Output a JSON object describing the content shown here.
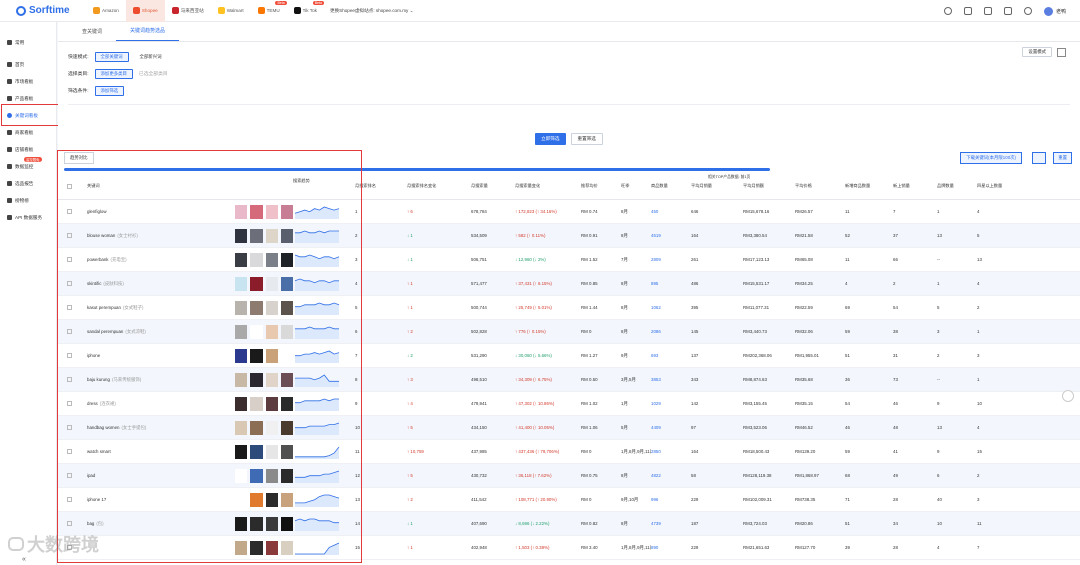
{
  "app": {
    "logo": "Sorftime"
  },
  "platforms": [
    {
      "label": "Amazon",
      "color": "#f29a1e"
    },
    {
      "label": "Shopee",
      "color": "#ee4d2d",
      "active": true
    },
    {
      "label": "马来西亚站",
      "color": "#c9252d"
    },
    {
      "label": "Walmart",
      "color": "#ffc220"
    },
    {
      "label": "TEMU",
      "color": "#fb7701",
      "badge": "Beta"
    },
    {
      "label": "Tik Tok",
      "color": "#111111",
      "badge": "Beta"
    }
  ],
  "site_select": "更换Shopee虚拟站点: shopee.com.my ⌄",
  "user": {
    "name": "老鸭"
  },
  "sidebar": {
    "items": [
      {
        "label": "常用"
      },
      {
        "label": "首页"
      },
      {
        "label": "市场看板"
      },
      {
        "label": "产品看板"
      },
      {
        "label": "关键词看板",
        "active": true
      },
      {
        "label": "商家看板"
      },
      {
        "label": "店铺看板"
      },
      {
        "label": "数据监控",
        "badge": "监控限免"
      },
      {
        "label": "选品报告"
      },
      {
        "label": "榜物榜"
      },
      {
        "label": "API 数据服务"
      }
    ]
  },
  "tabs": [
    {
      "label": "查关键词"
    },
    {
      "label": "关键词趋势选品",
      "active": true
    }
  ],
  "filters": {
    "quick_label": "快速模式:",
    "quick_opts": [
      "全部关键词",
      "全部新兴词"
    ],
    "category_label": "选择类目:",
    "category_btn": "添加更多类目",
    "category_hint": "已选全部类目",
    "condition_label": "筛选条件:",
    "condition_btn": "添加筛选",
    "mode_btn": "设置模式"
  },
  "actions": {
    "primary": "立即筛选",
    "reset": "重置筛选"
  },
  "toolbar": {
    "trend": "趋势对比",
    "download": "下载关键词(本月限100次)",
    "reset": "重置"
  },
  "table": {
    "headers": [
      "关键词",
      "搜索趋势",
      "月搜索排名",
      "月搜索排名变化",
      "月搜索量",
      "月搜索量变化",
      "推荐均价",
      "旺季",
      "商品数量",
      "平均月销量",
      "平均月销额",
      "平均价格",
      "新增商品数量",
      "新上销量",
      "品牌数量",
      "四星以上数量"
    ],
    "group_header": "相关TOP产品数据: 前1页",
    "rows": [
      {
        "kw": "glenfiglow",
        "sub": "",
        "rank": "1",
        "chg": "↑ 6",
        "chgDir": "up",
        "search": "678,784",
        "growth": "↑ 172,823 (↑ 34.16%)",
        "gDir": "up",
        "price": "RM 0.74",
        "season": "8月",
        "count": "450",
        "sales": "646",
        "gmv": "RM15,678.16",
        "avg": "RM26.57",
        "new": "11",
        "sold": "7",
        "brand": "1",
        "star": "4",
        "spark": [
          3,
          4,
          5,
          4,
          6,
          5,
          7,
          6,
          5,
          6
        ],
        "thumbs": [
          "#e9b9c9",
          "#d46a7a",
          "#f0c0c8",
          "#c77e95"
        ]
      },
      {
        "kw": "blouse woman",
        "sub": "(女士衬衫)",
        "rank": "2",
        "chg": "↓ 1",
        "chgDir": "down",
        "search": "534,509",
        "growth": "↑ 582 (↑ 0.11%)",
        "gDir": "up",
        "price": "RM 0.91",
        "season": "8月",
        "count": "4519",
        "sales": "164",
        "gmv": "RM3,380.54",
        "avg": "RM21.58",
        "new": "52",
        "sold": "37",
        "brand": "13",
        "star": "5",
        "spark": [
          5,
          5,
          6,
          5,
          5,
          6,
          5,
          6,
          6,
          6
        ],
        "thumbs": [
          "#2f3340",
          "#6c6f7a",
          "#ddd5c8",
          "#5a5f6e"
        ]
      },
      {
        "kw": "powerbank",
        "sub": "(充电宝)",
        "rank": "3",
        "chg": "↓ 1",
        "chgDir": "down",
        "search": "506,751",
        "growth": "↓ 12,960 (↓ 2%)",
        "gDir": "down",
        "price": "RM 1.52",
        "season": "7月",
        "count": "2809",
        "sales": "261",
        "gmv": "RM17,123.13",
        "avg": "RM65.08",
        "new": "11",
        "sold": "66",
        "brand": "--",
        "star": "13",
        "spark": [
          6,
          5,
          5,
          6,
          5,
          4,
          5,
          5,
          4,
          5
        ],
        "thumbs": [
          "#3a3d44",
          "#d9d9dc",
          "#7a7f88",
          "#1f2226"
        ]
      },
      {
        "kw": "skintific",
        "sub": "(皮肤科技)",
        "rank": "4",
        "chg": "↑ 1",
        "chgDir": "up",
        "search": "571,477",
        "growth": "↑ 37,431 (↑ 6.15%)",
        "gDir": "up",
        "price": "RM 0.85",
        "season": "8月",
        "count": "895",
        "sales": "486",
        "gmv": "RM15,531.17",
        "avg": "RM34.25",
        "new": "4",
        "sold": "2",
        "brand": "1",
        "star": "4",
        "spark": [
          5,
          6,
          5,
          5,
          4,
          5,
          5,
          4,
          5,
          5
        ],
        "thumbs": [
          "#c9e4f1",
          "#8b1d2a",
          "#e6e9ee",
          "#4a6fa8"
        ]
      },
      {
        "kw": "kasut perempuan",
        "sub": "(女式鞋子)",
        "rank": "5",
        "chg": "↑ 1",
        "chgDir": "up",
        "search": "500,744",
        "growth": "↑ 25,749 (↑ 5.01%)",
        "gDir": "up",
        "price": "RM 1.44",
        "season": "8月",
        "count": "1062",
        "sales": "395",
        "gmv": "RM11,077.31",
        "avg": "RM22.59",
        "new": "69",
        "sold": "54",
        "brand": "5",
        "star": "2",
        "spark": [
          4,
          4,
          5,
          5,
          5,
          6,
          5,
          5,
          6,
          5
        ],
        "thumbs": [
          "#b8b3ad",
          "#8c7b6e",
          "#d8d2cc",
          "#5c534c"
        ]
      },
      {
        "kw": "sandal perempuan",
        "sub": "(女式凉鞋)",
        "rank": "6",
        "chg": "↑ 2",
        "chgDir": "up",
        "search": "502,828",
        "growth": "↑ 776 (↑ 0.15%)",
        "gDir": "up",
        "price": "RM 0",
        "season": "8月",
        "count": "2086",
        "sales": "145",
        "gmv": "RM3,440.73",
        "avg": "RM32.06",
        "new": "59",
        "sold": "38",
        "brand": "3",
        "star": "1",
        "spark": [
          5,
          5,
          5,
          6,
          5,
          5,
          5,
          6,
          5,
          5
        ],
        "thumbs": [
          "#a9a9a9",
          "#ffffff",
          "#e8c9b0",
          "#d9d9d9"
        ]
      },
      {
        "kw": "iphone",
        "sub": "",
        "rank": "7",
        "chg": "↓ 2",
        "chgDir": "down",
        "search": "531,290",
        "growth": "↓ 30,060 (↓ 5.66%)",
        "gDir": "down",
        "price": "RM 1.27",
        "season": "9月",
        "count": "693",
        "sales": "137",
        "gmv": "RM202,368.06",
        "avg": "RM1,955.01",
        "new": "51",
        "sold": "31",
        "brand": "2",
        "star": "3",
        "spark": [
          4,
          4,
          5,
          5,
          6,
          5,
          6,
          7,
          5,
          6
        ],
        "thumbs": [
          "#2b3a8f",
          "#1a1a1a",
          "#c9a27a",
          "#ffffff"
        ]
      },
      {
        "kw": "baju kurung",
        "sub": "(马来传统服饰)",
        "rank": "8",
        "chg": "↑ 3",
        "chgDir": "up",
        "search": "498,510",
        "growth": "↑ 34,309 (↑ 6.75%)",
        "gDir": "up",
        "price": "RM 0.50",
        "season": "3月,5月",
        "count": "3853",
        "sales": "343",
        "gmv": "RM8,874.63",
        "avg": "RM35.68",
        "new": "36",
        "sold": "73",
        "brand": "--",
        "star": "1",
        "spark": [
          5,
          5,
          5,
          5,
          4,
          5,
          7,
          3,
          3,
          3
        ],
        "thumbs": [
          "#c8b8a6",
          "#2a2730",
          "#e0d4c9",
          "#6b4d55"
        ]
      },
      {
        "kw": "dress",
        "sub": "(连衣裙)",
        "rank": "9",
        "chg": "↑ 4",
        "chgDir": "up",
        "search": "479,941",
        "growth": "↑ 47,302 (↑ 10.86%)",
        "gDir": "up",
        "price": "RM 1.02",
        "season": "1月",
        "count": "1029",
        "sales": "142",
        "gmv": "RM3,155.45",
        "avg": "RM35.15",
        "new": "54",
        "sold": "46",
        "brand": "9",
        "star": "10",
        "spark": [
          4,
          4,
          5,
          5,
          5,
          5,
          6,
          5,
          6,
          6
        ],
        "thumbs": [
          "#3b2c2e",
          "#d8cfc8",
          "#5c3b3f",
          "#2a2a2a"
        ]
      },
      {
        "kw": "handbag women",
        "sub": "(女士手提包)",
        "rank": "10",
        "chg": "↑ 5",
        "chgDir": "up",
        "search": "434,150",
        "growth": "↑ 41,400 (↑ 10.05%)",
        "gDir": "up",
        "price": "RM 1.06",
        "season": "5月",
        "count": "4409",
        "sales": "97",
        "gmv": "RM3,523.06",
        "avg": "RM46.52",
        "new": "46",
        "sold": "48",
        "brand": "13",
        "star": "4",
        "spark": [
          4,
          4,
          4,
          5,
          5,
          5,
          5,
          6,
          6,
          7
        ],
        "thumbs": [
          "#d9c8b4",
          "#8c6e55",
          "#f0f0f0",
          "#4b3a2e"
        ]
      },
      {
        "kw": "watch smart",
        "sub": "",
        "rank": "11",
        "chg": "↑ 10,759",
        "chgDir": "up",
        "search": "437,985",
        "growth": "↑ 437,436 (↑ 79,706%)",
        "gDir": "up",
        "price": "RM 0",
        "season": "1月,8月,9月,11月",
        "count": "2850",
        "sales": "164",
        "gmv": "RM18,500.43",
        "avg": "RM139.20",
        "new": "59",
        "sold": "41",
        "brand": "9",
        "star": "15",
        "spark": [
          1,
          1,
          1,
          1,
          1,
          1,
          1,
          2,
          4,
          9
        ],
        "thumbs": [
          "#1a1a1a",
          "#2d4b7a",
          "#e6e6e6",
          "#505050"
        ]
      },
      {
        "kw": "ipad",
        "sub": "",
        "rank": "12",
        "chg": "↑ 5",
        "chgDir": "up",
        "search": "430,732",
        "growth": "↑ 36,118 (↑ 7.62%)",
        "gDir": "up",
        "price": "RM 0.75",
        "season": "8月",
        "count": "4822",
        "sales": "58",
        "gmv": "RM128,119.38",
        "avg": "RM1,868.97",
        "new": "68",
        "sold": "49",
        "brand": "6",
        "star": "2",
        "spark": [
          3,
          3,
          3,
          4,
          4,
          4,
          5,
          5,
          6,
          7
        ],
        "thumbs": [
          "#ffffff",
          "#3f6bb5",
          "#8a8a8a",
          "#2b2b2b"
        ]
      },
      {
        "kw": "iphone 17",
        "sub": "",
        "rank": "13",
        "chg": "↑ 2",
        "chgDir": "up",
        "search": "411,542",
        "growth": "↑ 108,771 (↑ 20.90%)",
        "gDir": "up",
        "price": "RM 0",
        "season": "9月,10月",
        "count": "996",
        "sales": "229",
        "gmv": "RM102,009.31",
        "avg": "RM738.35",
        "new": "71",
        "sold": "28",
        "brand": "40",
        "star": "3",
        "spark": [
          2,
          2,
          2,
          3,
          4,
          6,
          7,
          7,
          6,
          5
        ],
        "thumbs": [
          "#ffffff",
          "#e07a2e",
          "#2b2b2b",
          "#c8a27c"
        ]
      },
      {
        "kw": "bag",
        "sub": "(包)",
        "rank": "14",
        "chg": "↓ 1",
        "chgDir": "down",
        "search": "407,690",
        "growth": "↓ 8,696 (↓ 2.22%)",
        "gDir": "down",
        "price": "RM 0.82",
        "season": "8月",
        "count": "4739",
        "sales": "187",
        "gmv": "RM3,724.03",
        "avg": "RM20.86",
        "new": "51",
        "sold": "34",
        "brand": "10",
        "star": "11",
        "spark": [
          5,
          6,
          5,
          6,
          6,
          5,
          5,
          5,
          4,
          4
        ],
        "thumbs": [
          "#1a1a1a",
          "#2b2b2b",
          "#3a3a3a",
          "#111111"
        ]
      },
      {
        "kw": "",
        "sub": "",
        "rank": "15",
        "chg": "↑ 1",
        "chgDir": "up",
        "search": "402,948",
        "growth": "↑ 1,503 (↑ 0.38%)",
        "gDir": "up",
        "price": "RM 3.40",
        "season": "1月,8月,9月,11月",
        "count": "890",
        "sales": "229",
        "gmv": "RM21,651.63",
        "avg": "RM127.70",
        "new": "39",
        "sold": "28",
        "brand": "4",
        "star": "7",
        "spark": [
          0,
          0,
          0,
          0,
          0,
          0,
          0,
          3,
          4,
          5
        ],
        "thumbs": [
          "#c2a98a",
          "#2b2b2b",
          "#8a3a3a",
          "#d8cfc0"
        ]
      }
    ]
  },
  "watermark": "大数跨境",
  "colors": {
    "accent": "#2f6fe8",
    "annotation": "#e23a3a",
    "up": "#d33a2c",
    "down": "#22a06b"
  }
}
